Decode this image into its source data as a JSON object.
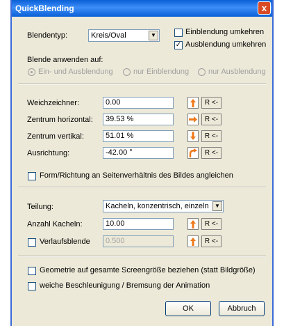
{
  "window": {
    "title": "QuickBlending",
    "close_glyph": "x"
  },
  "blendentyp": {
    "label": "Blendentyp:",
    "value": "Kreis/Oval"
  },
  "checks_top": {
    "einblendung": {
      "label": "Einblendung umkehren",
      "checked": false
    },
    "ausblendung": {
      "label": "Ausblendung umkehren",
      "checked": true
    }
  },
  "blende": {
    "label": "Blende anwenden auf:",
    "options": [
      "Ein- und Ausblendung",
      "nur Einblendung",
      "nur Ausblendung"
    ],
    "selected": 0
  },
  "params": [
    {
      "label": "Weichzeichner:",
      "value": "0.00",
      "arrow_icon": "arrow-up-icon",
      "reset": "R <-"
    },
    {
      "label": "Zentrum horizontal:",
      "value": "39.53 %",
      "arrow_icon": "arrow-right-icon",
      "reset": "R <-"
    },
    {
      "label": "Zentrum vertikal:",
      "value": "51.01 %",
      "arrow_icon": "arrow-down-icon",
      "reset": "R <-"
    },
    {
      "label": "Ausrichtung:",
      "value": "-42.00 °",
      "arrow_icon": "rotate-icon",
      "reset": "R <-"
    }
  ],
  "form_check": {
    "label": "Form/Richtung an Seitenverhältnis des Bildes angleichen",
    "checked": false
  },
  "teilung": {
    "label": "Teilung:",
    "value": "Kacheln, konzentrisch, einzeln dr"
  },
  "kacheln": {
    "label": "Anzahl Kacheln:",
    "value": "10.00",
    "reset": "R <-"
  },
  "verlauf": {
    "label": "Verlaufsblende",
    "value": "0.500",
    "checked": false,
    "reset": "R <-"
  },
  "bottom_checks": {
    "geometrie": {
      "label": "Geometrie auf gesamte Screengröße beziehen (statt Bildgröße)",
      "checked": false
    },
    "beschleunigung": {
      "label": "weiche Beschleunigung / Bremsung der Animation",
      "checked": false
    }
  },
  "buttons": {
    "ok": "OK",
    "cancel": "Abbruch"
  },
  "colors": {
    "title_bar": "#0a5fd6",
    "dialog_bg": "#ece9d8",
    "arrow_orange": "#f07818"
  }
}
